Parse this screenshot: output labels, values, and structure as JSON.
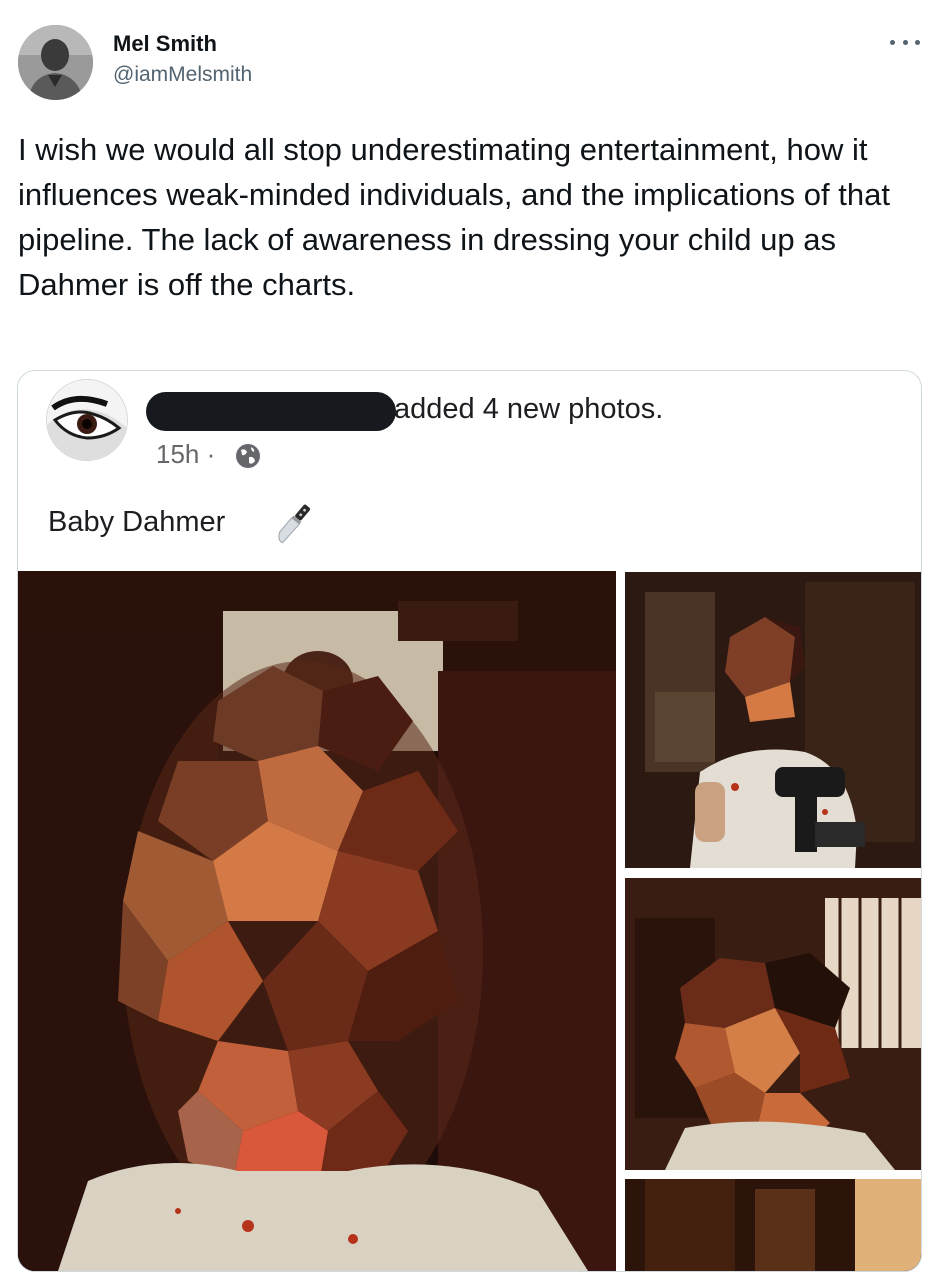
{
  "tweet": {
    "author": {
      "display_name": "Mel Smith",
      "handle": "@iamMelsmith"
    },
    "more_icon": "more-horizontal-icon",
    "text": "I wish we would all stop underestimating entertainment, how it influences weak-minded individuals, and the implications of that pipeline. The lack of awareness in dressing your child up as Dahmer is off the charts."
  },
  "embedded_post": {
    "action_text": "added 4 new photos.",
    "timestamp": "15h ·",
    "privacy_icon": "globe-icon",
    "caption": "Baby Dahmer",
    "caption_emoji_icon": "kitchen-knife-icon",
    "photo_count": 4
  },
  "colors": {
    "text_primary": "#0f1419",
    "text_secondary": "#536471",
    "border": "#cfd9de",
    "fb_text": "#1c1e21",
    "fb_meta": "#65676b"
  }
}
